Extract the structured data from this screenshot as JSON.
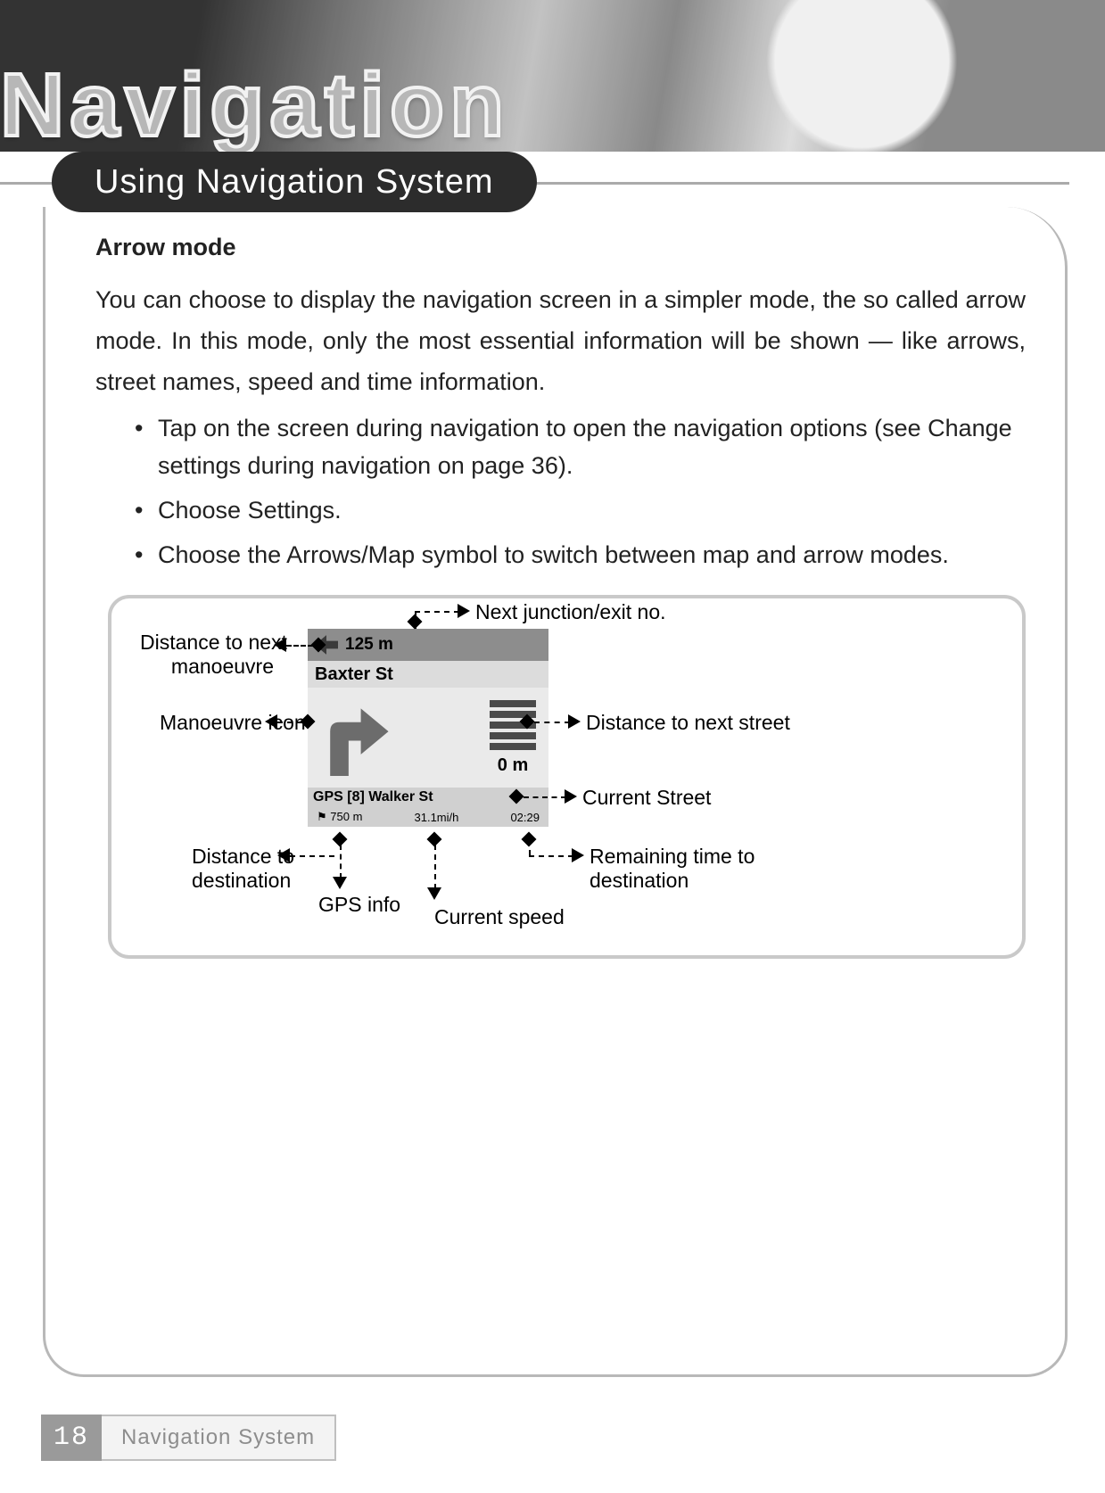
{
  "banner": {
    "word": "Navigation"
  },
  "section_title": "Using Navigation System",
  "heading": "Arrow mode",
  "paragraph": "You can choose to display the navigation screen in a simpler mode, the so called arrow mode. In this mode, only the most essential information will be shown — like arrows, street names, speed and time information.",
  "bullets": [
    "Tap on the screen during navigation to open the navigation options (see Change settings during navigation on page 36).",
    "Choose Settings.",
    "Choose the Arrows/Map symbol to switch between map and arrow modes."
  ],
  "device": {
    "distance_next_manoeuvre": "125 m",
    "next_street": "Baxter St",
    "distance_next_street": "0 m",
    "current_street_line": "GPS [8] Walker St",
    "distance_destination": "750 m",
    "current_speed": "31.1mi/h",
    "remaining_time": "02:29"
  },
  "callouts": {
    "next_junction": "Next junction/exit no.",
    "dist_manoeuvre": "Distance to next\nmanoeuvre",
    "manoeuvre_icon": "Manoeuvre icon",
    "dist_next_street": "Distance to next street",
    "current_street": "Current Street",
    "dist_destination": "Distance to\ndestination",
    "gps_info": "GPS info",
    "current_speed": "Current speed",
    "remaining_time": "Remaining time to\ndestination"
  },
  "footer": {
    "page": "18",
    "label": "Navigation System"
  }
}
